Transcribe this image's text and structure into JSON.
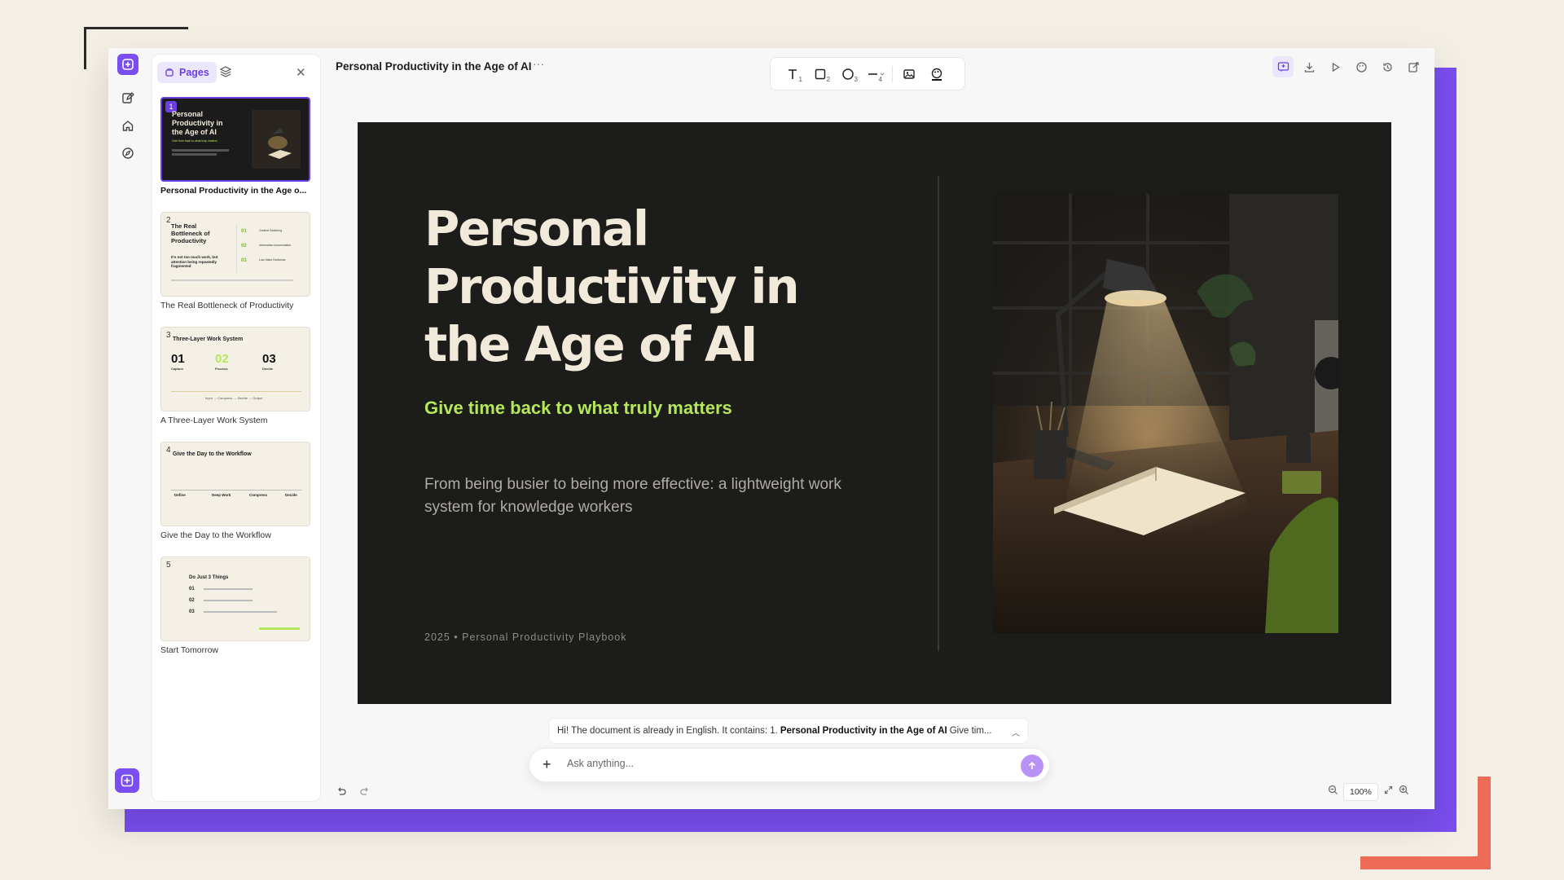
{
  "app": {
    "title": "Personal Productivity in the Age of AI",
    "more": "···"
  },
  "panel": {
    "pages_tab": "Pages"
  },
  "pages": [
    {
      "num": "1",
      "label": "Personal Productivity in the Age o...",
      "mini_title": "Personal Productivity in the Age of AI",
      "mini_sub": "Give time back to what truly matters"
    },
    {
      "num": "2",
      "label": "The Real Bottleneck of Productivity",
      "mini_title": "The Real Bottleneck of Productivity",
      "mini_sub": "It's not too much work, but attention being repeatedly fragmented",
      "mini_items": [
        "01",
        "02",
        "03"
      ],
      "mini_heads": [
        "Context Switching",
        "Information Accumulation",
        "Low-Value Decisions"
      ]
    },
    {
      "num": "3",
      "label": "A Three-Layer Work System",
      "mini_title": "Three-Layer Work System",
      "mini_cols": [
        {
          "n": "01",
          "h": "Capture"
        },
        {
          "n": "02",
          "h": "Process"
        },
        {
          "n": "03",
          "h": "Decide"
        }
      ],
      "mini_flow": "Input → Compress → Decide → Output"
    },
    {
      "num": "4",
      "label": "Give the Day to the Workflow",
      "mini_title": "Give the Day to the Workflow",
      "mini_steps": [
        "Define",
        "Deep Work",
        "Compress",
        "Decide"
      ]
    },
    {
      "num": "5",
      "label": "Start Tomorrow",
      "mini_title": "Do Just 3 Things",
      "mini_items": [
        "01",
        "02",
        "03"
      ]
    }
  ],
  "toolbar": {
    "text_sub": "1",
    "rect_sub": "2",
    "ellipse_sub": "3",
    "line_sub": "4"
  },
  "slide": {
    "title": "Personal Productivity in the Age of AI",
    "subtitle": "Give time back to what truly matters",
    "description": "From being busier to being more effective: a lightweight work system for knowledge workers",
    "footer": "2025 • Personal Productivity Playbook"
  },
  "chat": {
    "preview_prefix": "Hi! The document is already in English. It contains: 1.",
    "preview_bold": "Personal Productivity in the Age of AI",
    "preview_suffix": "Give tim...",
    "placeholder": "Ask anything..."
  },
  "zoom": {
    "value": "100%"
  },
  "colors": {
    "accent": "#7a4ef0",
    "slide_bg": "#1c1c1b",
    "subtitle": "#b6e65a",
    "coral": "#ee6b58"
  }
}
